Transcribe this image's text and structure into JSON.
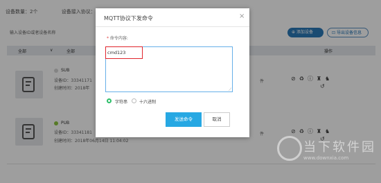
{
  "stats": {
    "device_count_label": "设备数量：2个",
    "access_label": "设备接入协议：MQTT"
  },
  "toolbar": {
    "search_placeholder": "输入设备ID或者设备名称",
    "add_button": "添加设备",
    "export_button": "导出设备信息"
  },
  "table": {
    "col_all_1": "全部",
    "col_all_2": "全部",
    "col_ops": "操作"
  },
  "devices": [
    {
      "name": "SUB",
      "id_label": "设备ID：33341171",
      "created_label": "创建时间：2018年",
      "status_color": "#d5d5d5",
      "tail": "件"
    },
    {
      "name": "PUB",
      "id_label": "设备ID：33341181",
      "created_label": "创建时间：2018年06月14日 11:04:02",
      "status_color": "#8dc63f",
      "tail": "件"
    }
  ],
  "modal": {
    "title": "MQTT协议下发命令",
    "close": "×",
    "content_label": "命令内容:",
    "required_mark": "*",
    "command_value": "cmd123",
    "radio_string": "字符串",
    "radio_hex": "十六进制",
    "send_button": "发送命令",
    "cancel_button": "取消"
  },
  "watermark": {
    "text": "当下软件园",
    "url": "www.downxia.com"
  }
}
